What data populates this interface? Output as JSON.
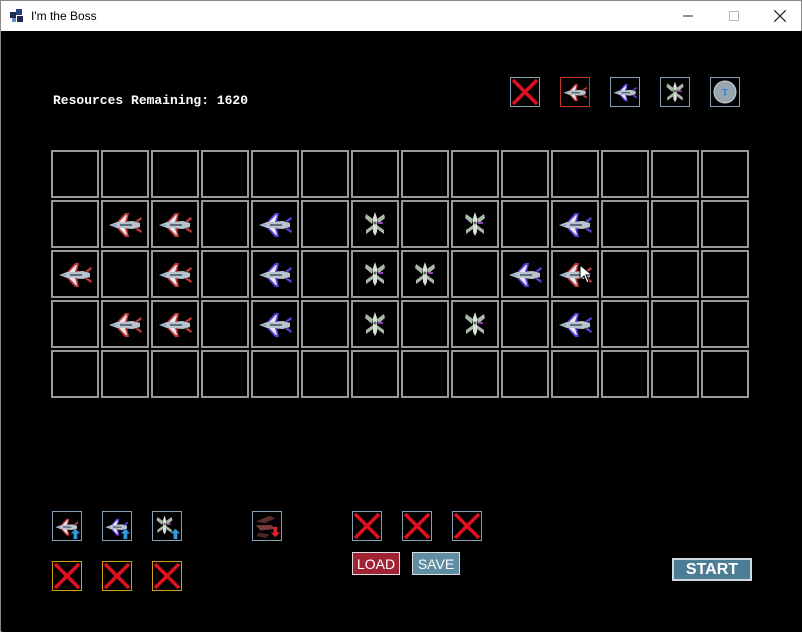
{
  "window": {
    "title": "I'm the Boss"
  },
  "hud": {
    "resources_text": "Resources Remaining: 1620"
  },
  "colors": {
    "ship_a_stripe": "#c23b3b",
    "ship_b_stripe": "#5a3ed9",
    "ship_c_body": "#a9b8a9",
    "coin": "#9aa6ae",
    "coin_letter": "#2e86de",
    "x_red": "#e1101e"
  },
  "top_toolbar": [
    {
      "name": "remove-tool",
      "icon": "x-icon",
      "style": "red-x"
    },
    {
      "name": "ship-a-tool",
      "icon": "fighter-ship-red-icon",
      "style": "red-border"
    },
    {
      "name": "ship-b-tool",
      "icon": "fighter-ship-purple-icon",
      "style": "blue-border"
    },
    {
      "name": "ship-c-tool",
      "icon": "winged-ship-icon",
      "style": "blue-border"
    },
    {
      "name": "coin-tool",
      "icon": "coin-icon",
      "letter": "T"
    }
  ],
  "grid": {
    "cols": 14,
    "rows": 5,
    "cells": [
      "..............",
      ".AA.B.C.C.B...",
      "A.A.B.CC.BA...",
      ".AA.B.C.C.B...",
      ".............."
    ],
    "legend": {
      "A": "fighter-ship-red-icon",
      "B": "fighter-ship-purple-icon",
      "C": "winged-ship-icon"
    }
  },
  "bottom_upgrades": [
    {
      "name": "upgrade-ship-a",
      "icon": "fighter-ship-red-up-icon"
    },
    {
      "name": "upgrade-ship-b",
      "icon": "fighter-ship-purple-up-icon"
    },
    {
      "name": "upgrade-ship-c",
      "icon": "winged-ship-up-icon"
    },
    {
      "name": "downgrade-ship",
      "icon": "broken-ship-down-icon"
    }
  ],
  "bottom_slots_row1": 3,
  "bottom_slots_row2": 3,
  "buttons": {
    "load": "LOAD",
    "save": "SAVE",
    "start": "START"
  }
}
